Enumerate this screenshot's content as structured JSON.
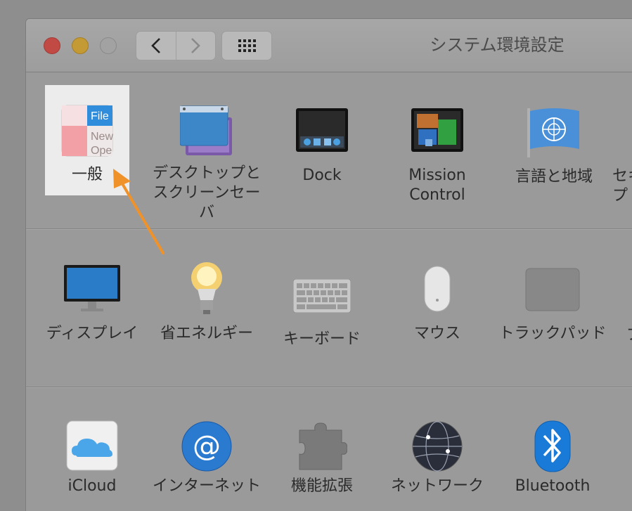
{
  "window": {
    "title": "システム環境設定"
  },
  "toolbar": {
    "back_icon": "chevron-left-icon",
    "forward_icon": "chevron-right-icon",
    "show_all_icon": "grid-icon"
  },
  "rows": [
    [
      {
        "id": "general",
        "label": "一般"
      },
      {
        "id": "desktop",
        "label": "デスクトップと\nスクリーンセーバ"
      },
      {
        "id": "dock",
        "label": "Dock"
      },
      {
        "id": "mission",
        "label": "Mission\nControl"
      },
      {
        "id": "language",
        "label": "言語と地域"
      },
      {
        "id": "security",
        "label": "セキ\nプ"
      }
    ],
    [
      {
        "id": "displays",
        "label": "ディスプレイ"
      },
      {
        "id": "energy",
        "label": "省エネルギー"
      },
      {
        "id": "keyboard",
        "label": "キーボード"
      },
      {
        "id": "mouse",
        "label": "マウス"
      },
      {
        "id": "trackpad",
        "label": "トラックパッド"
      },
      {
        "id": "printers",
        "label": "プ"
      }
    ],
    [
      {
        "id": "icloud",
        "label": "iCloud"
      },
      {
        "id": "internet",
        "label": "インターネット"
      },
      {
        "id": "extensions",
        "label": "機能拡張"
      },
      {
        "id": "network",
        "label": "ネットワーク"
      },
      {
        "id": "bluetooth",
        "label": "Bluetooth"
      }
    ]
  ],
  "general_icon_text": {
    "file": "File",
    "new": "New",
    "open": "Ope"
  },
  "colors": {
    "accent_arrow": "#f0922a",
    "selection": "#ececec"
  }
}
